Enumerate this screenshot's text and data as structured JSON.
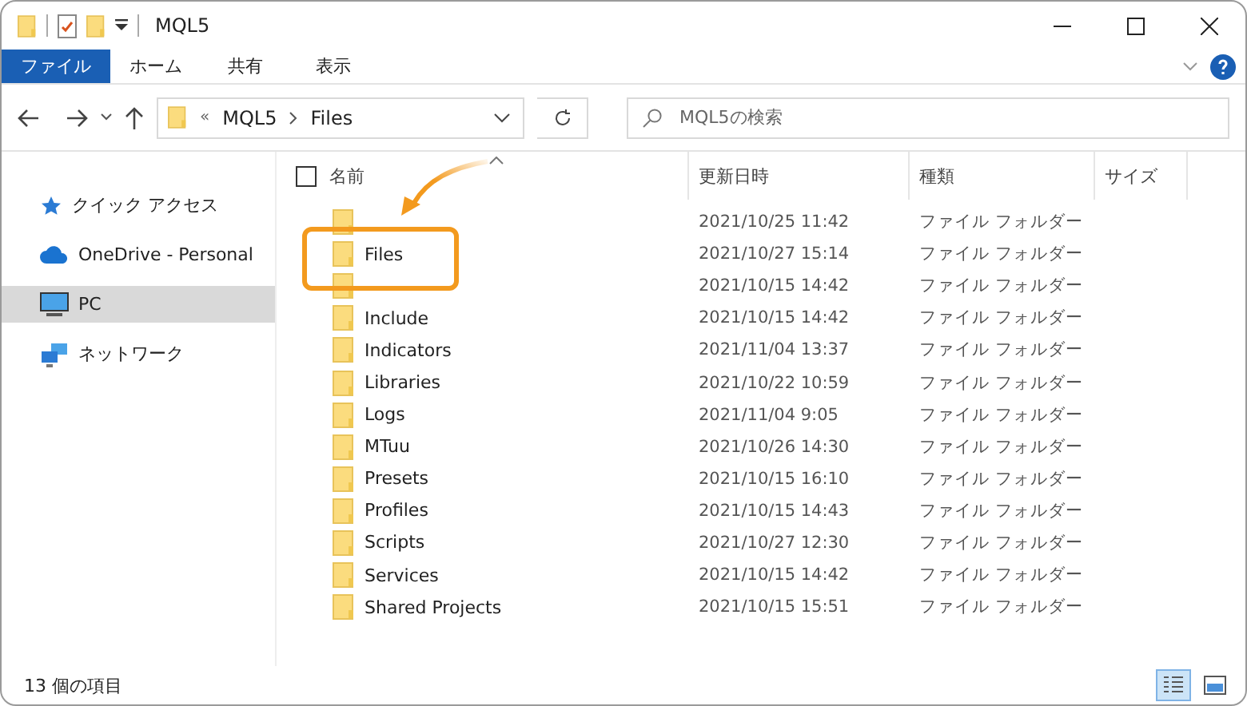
{
  "window": {
    "title": "MQL5"
  },
  "ribbon_tabs": [
    {
      "label": "ファイル",
      "selected": true
    },
    {
      "label": "ホーム",
      "selected": false
    },
    {
      "label": "共有",
      "selected": false
    },
    {
      "label": "表示",
      "selected": false
    }
  ],
  "address": {
    "prefix": "«",
    "crumbs": [
      "MQL5",
      "Files"
    ]
  },
  "search": {
    "placeholder": "MQL5の検索"
  },
  "sidebar": {
    "items": [
      {
        "kind": "star",
        "label": "クイック アクセス",
        "selected": false
      },
      {
        "kind": "cloud",
        "label": "OneDrive - Personal",
        "selected": false
      },
      {
        "kind": "pc",
        "label": "PC",
        "selected": true
      },
      {
        "kind": "network",
        "label": "ネットワーク",
        "selected": false
      }
    ]
  },
  "table": {
    "select_all": {
      "checked": false
    },
    "columns": [
      "名前",
      "更新日時",
      "種類",
      "サイズ"
    ],
    "rows": [
      {
        "date": "2021/10/25 11:42",
        "type": "ファイル フォルダー",
        "highlighted": false
      },
      {
        "name": "Files",
        "date": "2021/10/27 15:14",
        "type": "ファイル フォルダー",
        "highlighted": true
      },
      {
        "date": "2021/10/15 14:42",
        "type": "ファイル フォルダー",
        "highlighted": false
      },
      {
        "name": "Include",
        "date": "2021/10/15 14:42",
        "type": "ファイル フォルダー",
        "highlighted": false
      },
      {
        "name": "Indicators",
        "date": "2021/11/04 13:37",
        "type": "ファイル フォルダー",
        "highlighted": false
      },
      {
        "name": "Libraries",
        "date": "2021/10/22 10:59",
        "type": "ファイル フォルダー",
        "highlighted": false
      },
      {
        "name": "Logs",
        "date": "2021/11/04 9:05",
        "type": "ファイル フォルダー",
        "highlighted": false
      },
      {
        "name": "MTuu",
        "date": "2021/10/26 14:30",
        "type": "ファイル フォルダー",
        "highlighted": false
      },
      {
        "name": "Presets",
        "date": "2021/10/15 16:10",
        "type": "ファイル フォルダー",
        "highlighted": false
      },
      {
        "name": "Profiles",
        "date": "2021/10/15 14:43",
        "type": "ファイル フォルダー",
        "highlighted": false
      },
      {
        "name": "Scripts",
        "date": "2021/10/27 12:30",
        "type": "ファイル フォルダー",
        "highlighted": false
      },
      {
        "name": "Services",
        "date": "2021/10/15 14:42",
        "type": "ファイル フォルダー",
        "highlighted": false
      },
      {
        "name": "Shared Projects",
        "date": "2021/10/15 15:51",
        "type": "ファイル フォルダー",
        "highlighted": false
      }
    ]
  },
  "status_bar": {
    "count": "13 個の項目"
  }
}
